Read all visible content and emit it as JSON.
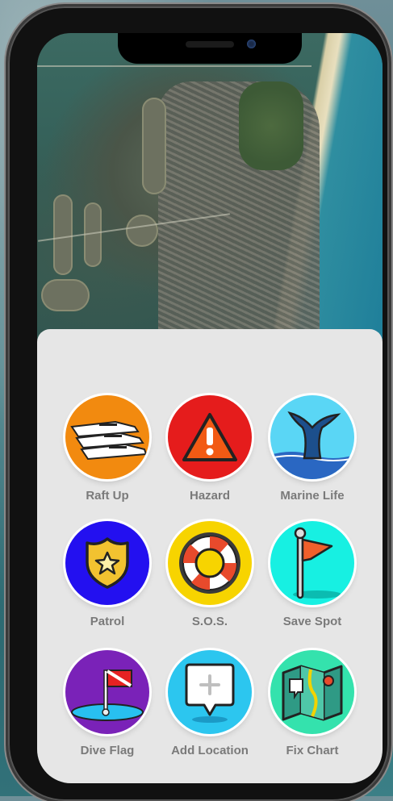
{
  "actions": [
    {
      "label": "Raft Up",
      "icon": "yachts-icon",
      "color": "#f28a0f"
    },
    {
      "label": "Hazard",
      "icon": "warning-icon",
      "color": "#e51c1c"
    },
    {
      "label": "Marine Life",
      "icon": "whale-tail-icon",
      "color": "#5ad6f5"
    },
    {
      "label": "Patrol",
      "icon": "police-badge-icon",
      "color": "#2310f0"
    },
    {
      "label": "S.O.S.",
      "icon": "life-ring-icon",
      "color": "#f7d400"
    },
    {
      "label": "Save Spot",
      "icon": "flag-pin-icon",
      "color": "#17f0e2"
    },
    {
      "label": "Dive Flag",
      "icon": "dive-flag-icon",
      "color": "#7a22b8"
    },
    {
      "label": "Add Location",
      "icon": "add-location-icon",
      "color": "#2cc6ef"
    },
    {
      "label": "Fix Chart",
      "icon": "folded-map-icon",
      "color": "#34e2ad"
    }
  ]
}
